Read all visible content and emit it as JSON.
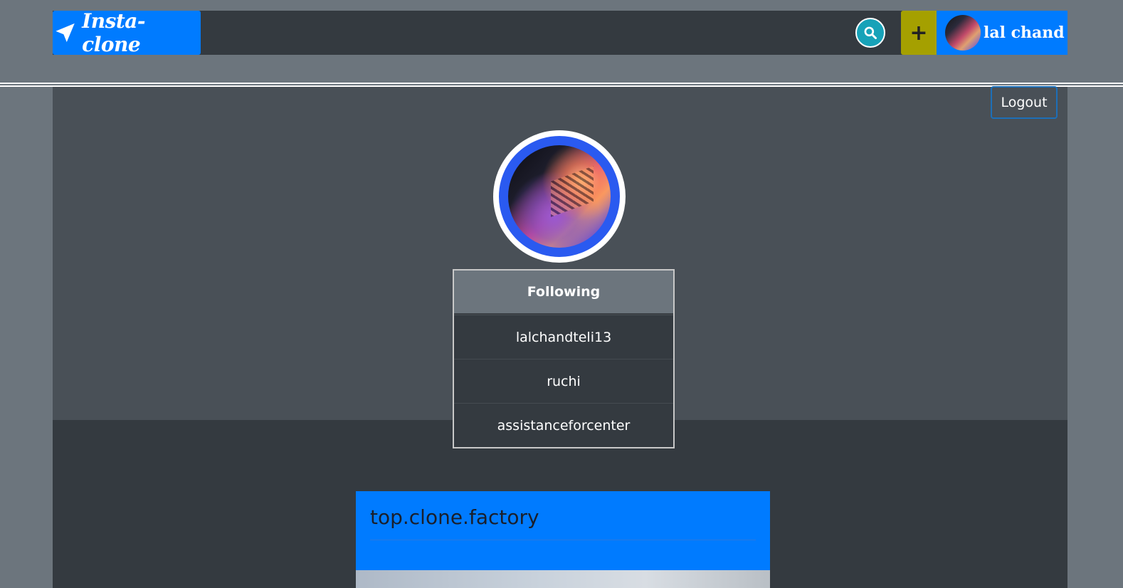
{
  "navbar": {
    "brand": "Insta-clone",
    "user_name": "lal chand",
    "plus_label": "+"
  },
  "profile": {
    "logout_label": "Logout",
    "following_title": "Following",
    "following": [
      "lalchandteli13",
      "ruchi",
      "assistanceforcenter"
    ]
  },
  "post": {
    "username": "top.clone.factory"
  },
  "colors": {
    "primary": "#007bff",
    "dark": "#343a40",
    "panel": "#495057",
    "background": "#6c757d",
    "search": "#17a2b8",
    "add": "#a5a000"
  },
  "icons": [
    "paper-plane-icon",
    "search-icon",
    "plus-icon"
  ]
}
